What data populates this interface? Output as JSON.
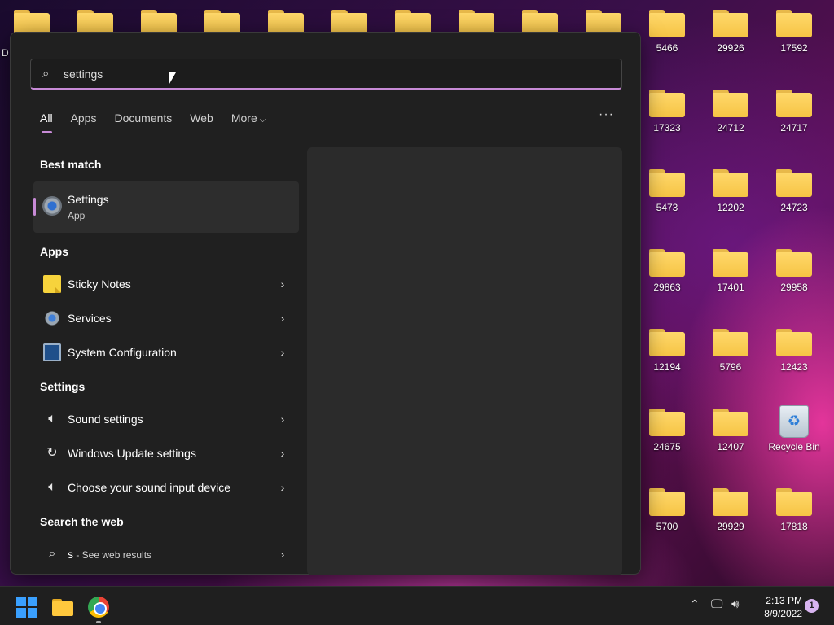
{
  "desktop": {
    "left_label_fragment": "D",
    "top_folders_count": 10,
    "icons": [
      {
        "label": "5466"
      },
      {
        "label": "29926"
      },
      {
        "label": "17592"
      },
      {
        "label": "17323"
      },
      {
        "label": "24712"
      },
      {
        "label": "24717"
      },
      {
        "label": "5473"
      },
      {
        "label": "12202"
      },
      {
        "label": "24723"
      },
      {
        "label": "29863"
      },
      {
        "label": "17401"
      },
      {
        "label": "29958"
      },
      {
        "label": "12194"
      },
      {
        "label": "5796"
      },
      {
        "label": "12423"
      },
      {
        "label": "24675"
      },
      {
        "label": "12407"
      },
      {
        "label": "Recycle Bin",
        "type": "recycle-bin"
      },
      {
        "label": "5700"
      },
      {
        "label": "29929"
      },
      {
        "label": "17818"
      }
    ]
  },
  "search": {
    "query": "settings",
    "icon": "search-icon"
  },
  "tabs": [
    {
      "label": "All",
      "active": true
    },
    {
      "label": "Apps"
    },
    {
      "label": "Documents"
    },
    {
      "label": "Web"
    },
    {
      "label": "More"
    }
  ],
  "more_options_label": "···",
  "best_match": {
    "heading": "Best match",
    "title": "Settings",
    "subtitle": "App",
    "icon": "settings-gear-icon"
  },
  "apps": {
    "heading": "Apps",
    "items": [
      {
        "label": "Sticky Notes",
        "icon": "sticky-notes-icon"
      },
      {
        "label": "Services",
        "icon": "services-gear-icon"
      },
      {
        "label": "System Configuration",
        "icon": "system-configuration-icon"
      }
    ]
  },
  "settings": {
    "heading": "Settings",
    "items": [
      {
        "label": "Sound settings",
        "icon": "speaker-icon"
      },
      {
        "label": "Windows Update settings",
        "icon": "sync-icon"
      },
      {
        "label": "Choose your sound input device",
        "icon": "speaker-icon"
      }
    ]
  },
  "web": {
    "heading": "Search the web",
    "query": "s",
    "suffix": " - See web results",
    "icon": "search-icon"
  },
  "taskbar": {
    "apps": [
      "start-icon",
      "file-explorer-icon",
      "chrome-icon"
    ],
    "clock_time": "2:13 PM",
    "clock_date": "8/9/2022",
    "notification_count": "1"
  },
  "colors": {
    "accent": "#c78ad6",
    "panel_bg": "#202020",
    "folder_yellow": "#ffd86b"
  }
}
